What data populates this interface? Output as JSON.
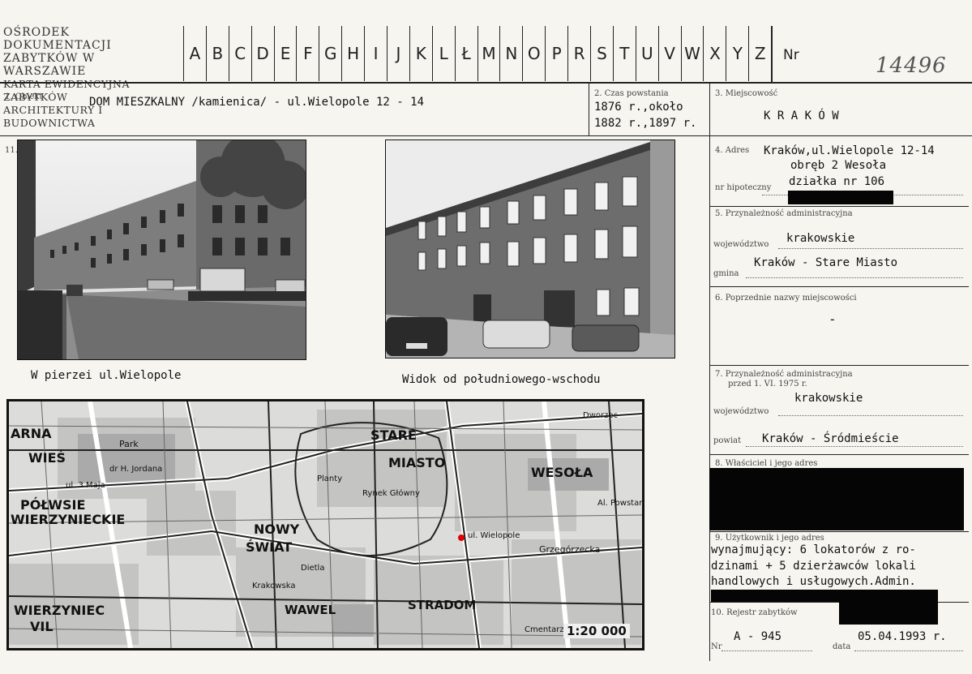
{
  "institution": {
    "line1": "OŚRODEK DOKUMENTACJI",
    "line2": "ZABYTKÓW W WARSZAWIE",
    "line3": "KARTA EWIDENCYJNA ZABYTKÓW",
    "line4": "ARCHITEKTURY I BUDOWNICTWA"
  },
  "alphabet": [
    "A",
    "B",
    "C",
    "D",
    "E",
    "F",
    "G",
    "H",
    "I",
    "J",
    "K",
    "L",
    "Ł",
    "M",
    "N",
    "O",
    "P",
    "R",
    "S",
    "T",
    "U",
    "V",
    "W",
    "X",
    "Y",
    "Z"
  ],
  "number": {
    "label": "Nr",
    "value": "14496"
  },
  "object": {
    "label": "1. Obiekt",
    "value": "DOM MIESZKALNY /kamienica/ - ul.Wielopole 12 - 14"
  },
  "creation_time": {
    "label": "2. Czas powstania",
    "line1": "1876 r.,około",
    "line2": "1882 r.,1897 r."
  },
  "locality": {
    "label": "3. Miejscowość",
    "value": "K R A K Ó W"
  },
  "address": {
    "label": "4. Adres",
    "line1": "Kraków,ul.Wielopole 12-14",
    "line2": "obręb 2 Wesoła",
    "line3": "działka nr 106",
    "mortgage_label": "nr hipoteczny"
  },
  "admin_current": {
    "label": "5. Przynależność administracyjna",
    "voivodeship_label": "województwo",
    "voivodeship": "krakowskie",
    "commune": "Kraków - Stare Miasto",
    "commune_label": "gmina"
  },
  "previous_names": {
    "label": "6. Poprzednie nazwy miejscowości",
    "value": "-"
  },
  "admin_before_1975": {
    "label_line1": "7. Przynależność administracyjna",
    "label_line2": "przed 1. VI. 1975 r.",
    "voivodeship": "krakowskie",
    "voivodeship_label": "województwo",
    "district_label": "powiat",
    "district": "Kraków - Śródmieście"
  },
  "owner": {
    "label": "8. Właściciel i jego adres"
  },
  "user": {
    "label": "9. Użytkownik i jego adres",
    "line1": "wynajmujący: 6 lokatorów z ro-",
    "line2": "dzinami + 5 dzierżawców lokali",
    "line3": "handlowych i usługowych.Admin."
  },
  "register": {
    "label": "10. Rejestr zabytków",
    "nr_label": "Nr",
    "nr": "A - 945",
    "date_label": "data",
    "date": "05.04.1993 r."
  },
  "photos_label": "11.",
  "photo1_caption": "W pierzei ul.Wielopole",
  "photo2_caption": "Widok od południowego-wschodu",
  "map": {
    "scale": "1:20 000",
    "labels": [
      "ARNA",
      "WIEŚ",
      "PÓŁWSIE",
      "WIERZYNIECKIE",
      "WIERZYNIEC",
      "VIL",
      "NOWY",
      "ŚWIAT",
      "STARE",
      "MIASTO",
      "WESOŁA",
      "STRADOM",
      "WAWEL",
      "Park",
      "dr H. Jordana",
      "Planty",
      "Rynek Główny",
      "ul. Wielopole",
      "Dworzec",
      "Grzegórzecka",
      "Krakowska",
      "Dietla",
      "Cmentarz Żydowski",
      "ul. 3 Maja",
      "Al. Powstania Warszawskiego"
    ]
  },
  "colors": {
    "paper": "#f6f5f0",
    "ink": "#111111",
    "redaction": "#050505"
  }
}
